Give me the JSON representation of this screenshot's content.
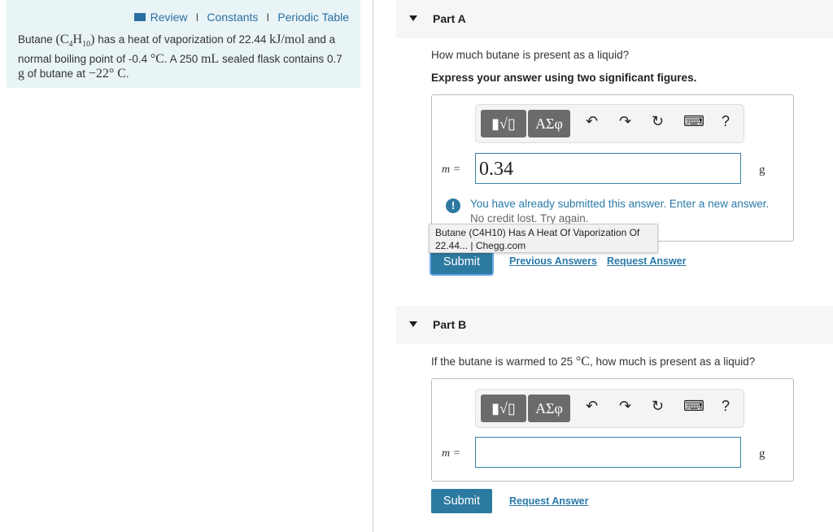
{
  "left": {
    "links": [
      "Review",
      "Constants",
      "Periodic Table"
    ],
    "separator": "I",
    "problem": {
      "t1": "Butane ",
      "formula_open": "(C",
      "sub4": "4",
      "h": "H",
      "sub10": "10",
      "formula_close": ")",
      "t2": " has a heat of vaporization of 22.44 ",
      "unit1": "kJ/mol",
      "t3": " and a normal boiling point of -0.4 ",
      "unit2": "°C",
      "t4": ". A 250 ",
      "unit3": "mL",
      "t5": " sealed flask contains 0.7 ",
      "unit4": "g",
      "t6": " of butane at ",
      "unit5": "−22° C",
      "t7": "."
    }
  },
  "partA": {
    "title": "Part A",
    "question": "How much butane is present as a liquid?",
    "instruction": "Express your answer using two significant figures.",
    "toolbar": {
      "templates": "▮√▯",
      "greek": "ΑΣφ",
      "undo": "↶",
      "redo": "↷",
      "reset": "↻",
      "keyboard": "⌨",
      "help": "?"
    },
    "var": "m =",
    "value": "0.34",
    "unit": "g",
    "feedback": {
      "line1": "You have already submitted this answer. Enter a new answer.",
      "line2": "No credit lost. Try again."
    },
    "submit": "Submit",
    "previous": "Previous Answers",
    "request": "Request Answer"
  },
  "tooltip": {
    "line1": "Butane (C4H10) Has A Heat Of Vaporization Of",
    "line2": "22.44... | Chegg.com"
  },
  "partB": {
    "title": "Part B",
    "question_pre": "If the butane is warmed to 25 ",
    "question_unit": "°C",
    "question_post": ", how much is present as a liquid?",
    "toolbar": {
      "templates": "▮√▯",
      "greek": "ΑΣφ",
      "undo": "↶",
      "redo": "↷",
      "reset": "↻",
      "keyboard": "⌨",
      "help": "?"
    },
    "var": "m =",
    "value": "",
    "unit": "g",
    "submit": "Submit",
    "request": "Request Answer"
  },
  "colors": {
    "accent": "#2d7aa0",
    "link": "#2a7aa8",
    "panel": "#e9f4f7"
  }
}
